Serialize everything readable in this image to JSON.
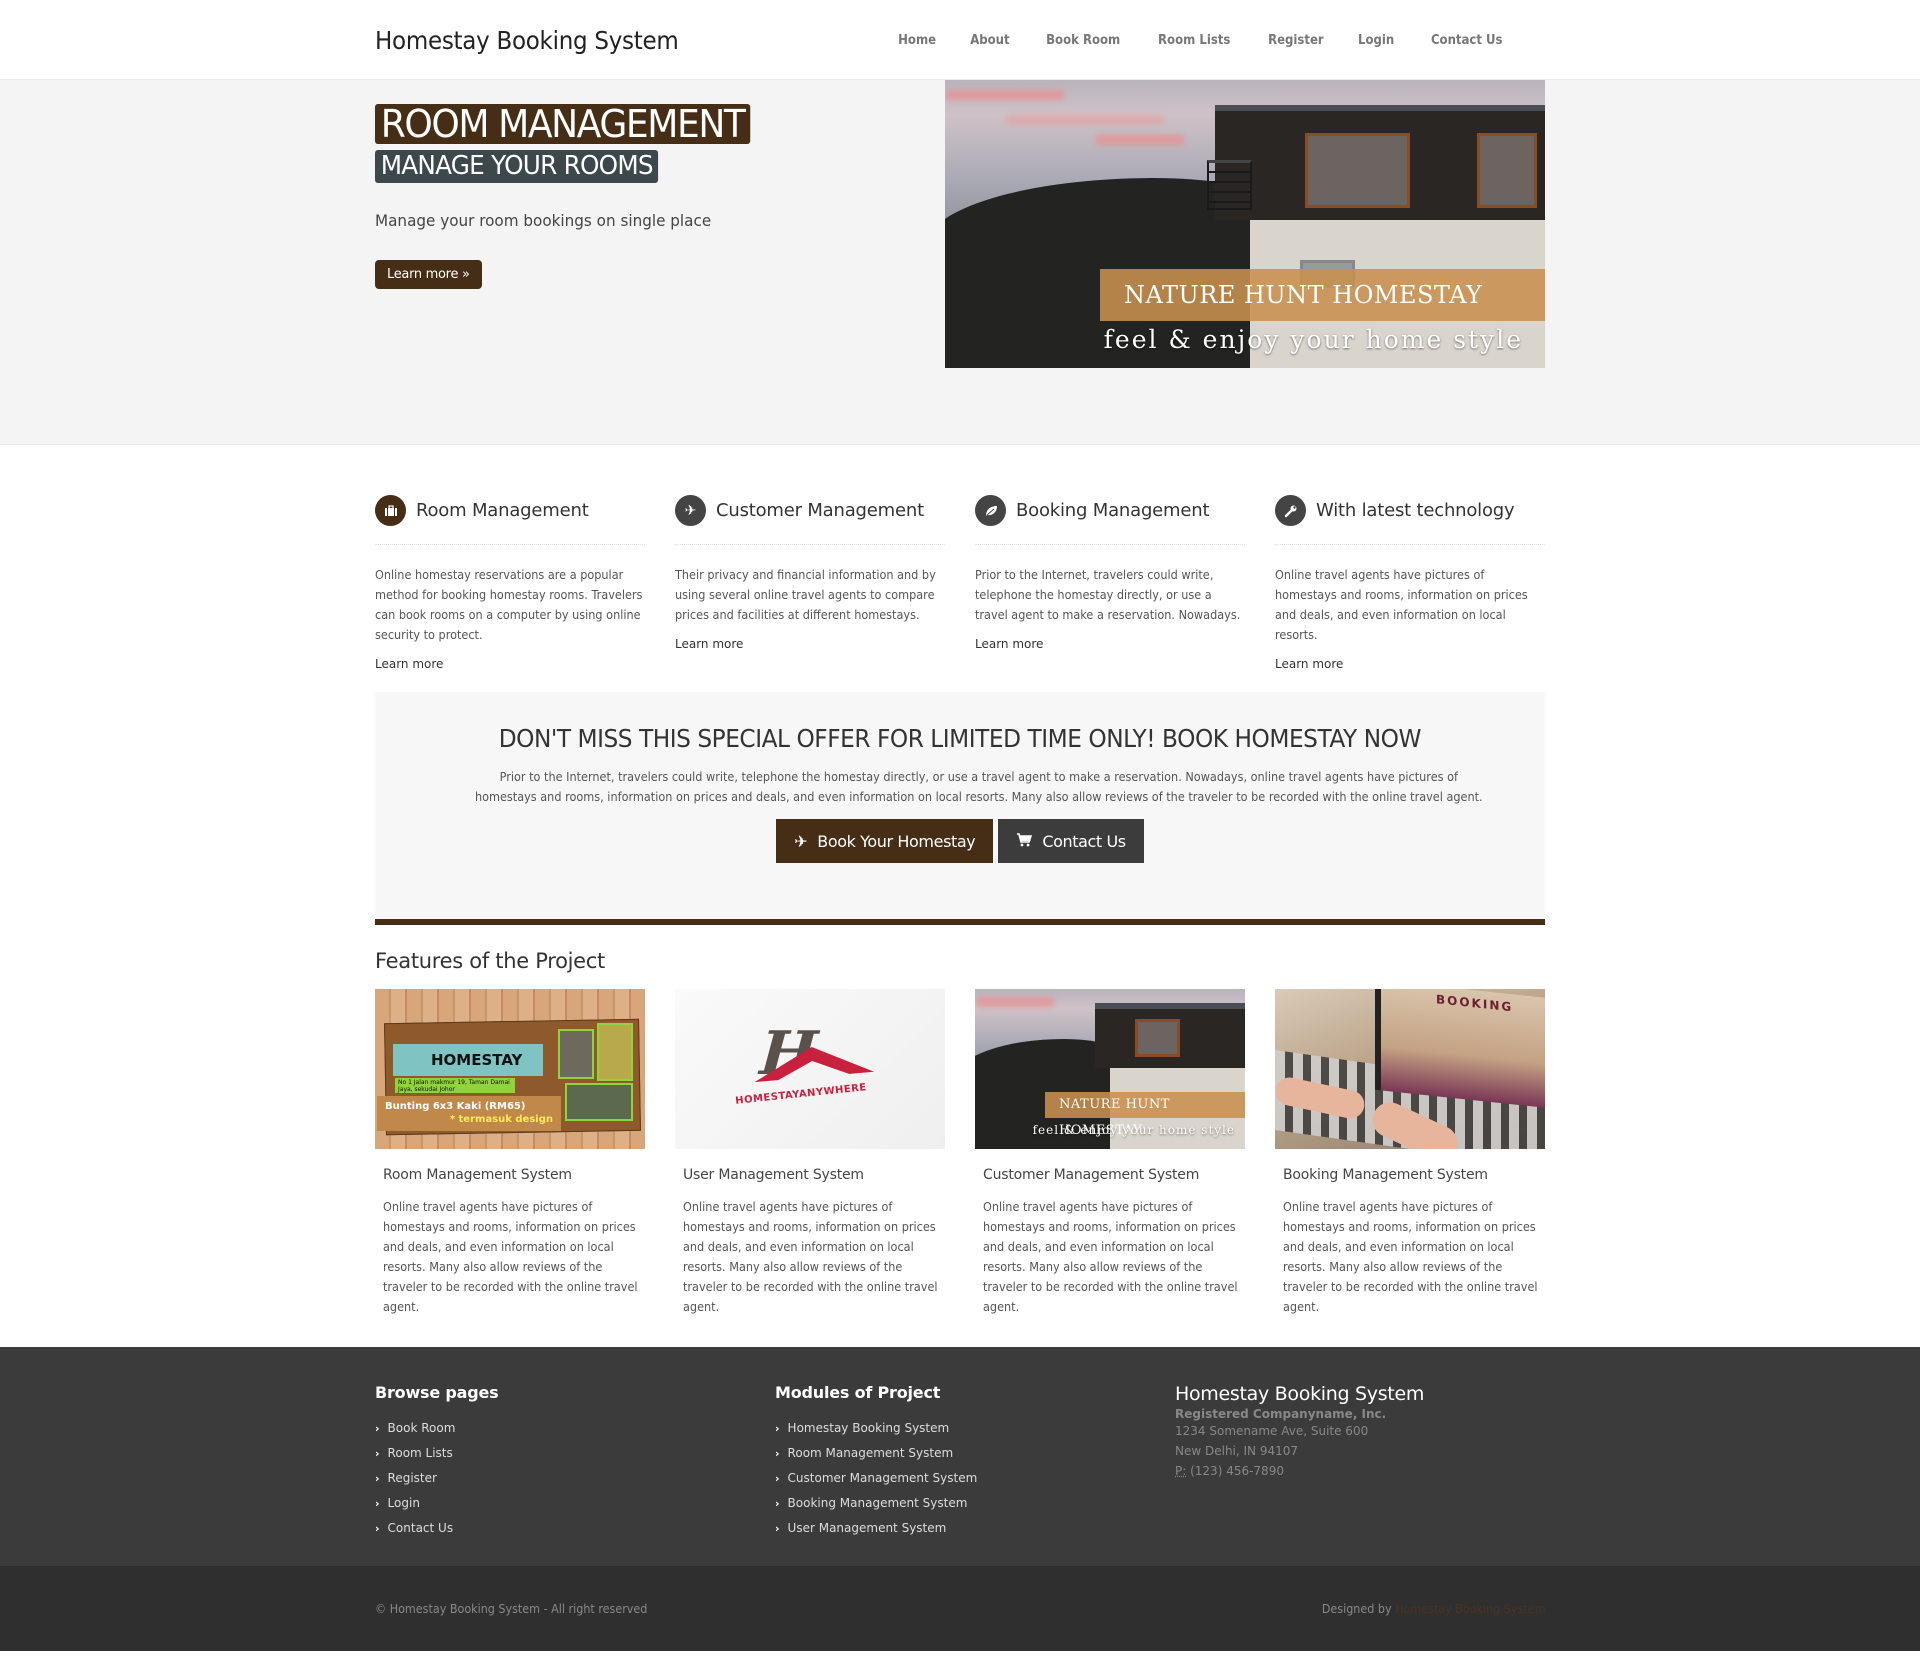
{
  "header": {
    "brand": "Homestay Booking System",
    "nav": [
      "Home",
      "About",
      "Book Room",
      "Room Lists",
      "Register",
      "Login",
      "Contact Us"
    ]
  },
  "hero": {
    "title": "ROOM MANAGEMENT",
    "subtitle": "MANAGE YOUR ROOMS",
    "tagline": "Manage your room bookings on single place",
    "button": "Learn more »",
    "image": {
      "banner": "NATURE HUNT HOMESTAY",
      "caption": "feel & enjoy your home style"
    }
  },
  "features": [
    {
      "icon": "briefcase-icon",
      "title": "Room Management",
      "text": "Online homestay reservations are a popular method for booking homestay rooms. Travelers can book rooms on a computer by using online security to protect.",
      "link": "Learn more"
    },
    {
      "icon": "plane-icon",
      "title": "Customer Management",
      "text": "Their privacy and financial information and by using several online travel agents to compare prices and facilities at different homestays.",
      "link": "Learn more"
    },
    {
      "icon": "leaf-icon",
      "title": "Booking Management",
      "text": "Prior to the Internet, travelers could write, telephone the homestay directly, or use a travel agent to make a reservation. Nowadays.",
      "link": "Learn more"
    },
    {
      "icon": "wrench-icon",
      "title": "With latest technology",
      "text": "Online travel agents have pictures of homestays and rooms, information on prices and deals, and even information on local resorts.",
      "link": "Learn more"
    }
  ],
  "offer": {
    "title": "DON'T MISS THIS SPECIAL OFFER FOR LIMITED TIME ONLY! BOOK HOMESTAY NOW",
    "text": "Prior to the Internet, travelers could write, telephone the homestay directly, or use a travel agent to make a reservation. Nowadays, online travel agents have pictures of homestays and rooms, information on prices and deals, and even information on local resorts. Many also allow reviews of the traveler to be recorded with the online travel agent.",
    "book_button": "Book Your Homestay",
    "contact_button": "Contact Us"
  },
  "project": {
    "heading": "Features of the Project",
    "cards": [
      {
        "title": "Room Management System",
        "text": "Online travel agents have pictures of homestays and rooms, information on prices and deals, and even information on local resorts. Many also allow reviews of the traveler to be recorded with the online travel agent.",
        "thumb": {
          "label": "HOMESTAY",
          "address": "No 1 Jalan makmur 19, Taman Damai Jaya, sekudai Johor",
          "promo_line1": "Bunting 6x3 Kaki (RM65)",
          "promo_line2": "* termasuk design"
        }
      },
      {
        "title": "User Management System",
        "text": "Online travel agents have pictures of homestays and rooms, information on prices and deals, and even information on local resorts. Many also allow reviews of the traveler to be recorded with the online travel agent.",
        "thumb": {
          "letter": "H",
          "wordmark": "HOMESTAYANYWHERE"
        }
      },
      {
        "title": "Customer Management System",
        "text": "Online travel agents have pictures of homestays and rooms, information on prices and deals, and even information on local resorts. Many also allow reviews of the traveler to be recorded with the online travel agent.",
        "thumb": {
          "banner": "NATURE HUNT HOMESTAY",
          "caption": "feel & enjoy your home style"
        }
      },
      {
        "title": "Booking Management System",
        "text": "Online travel agents have pictures of homestays and rooms, information on prices and deals, and even information on local resorts. Many also allow reviews of the traveler to be recorded with the online travel agent.",
        "thumb": {
          "screen_label": "BOOKING"
        }
      }
    ]
  },
  "footer": {
    "browse": {
      "heading": "Browse pages",
      "links": [
        "Book Room",
        "Room Lists",
        "Register",
        "Login",
        "Contact Us"
      ]
    },
    "modules": {
      "heading": "Modules of Project",
      "links": [
        "Homestay Booking System",
        "Room Management System",
        "Customer Management System",
        "Booking Management System",
        "User Management System"
      ]
    },
    "company": {
      "title": "Homestay Booking System",
      "name": "Registered Companyname, Inc.",
      "address1": "1234 Somename Ave, Suite 600",
      "address2": "New Delhi, IN 94107",
      "phone_label": "P:",
      "phone": "(123) 456-7890"
    },
    "copyright": "© Homestay Booking System - All right reserved",
    "designed_by_label": "Designed by",
    "designed_by_link": "Homestay Booking System"
  },
  "colors": {
    "brand_brown": "#462d15",
    "slate": "#3d484c",
    "footer_bg": "#3b3b3b",
    "footer_bottom_bg": "#2f2f2f",
    "hero_bg": "#f4f4f4"
  }
}
